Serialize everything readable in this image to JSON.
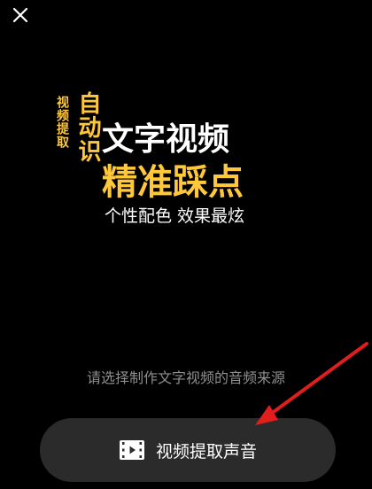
{
  "header": {
    "close_icon": "close-icon"
  },
  "promo": {
    "vertical_small": "视频提取",
    "vertical_big": "自动识",
    "line1": "文字视频",
    "line2": "精准踩点",
    "line3": "个性配色 效果最炫"
  },
  "hint": "请选择制作文字视频的音频来源",
  "extract_button": {
    "icon": "video-film-icon",
    "label": "视频提取声音"
  },
  "colors": {
    "accent": "#ffc83a",
    "background": "#000000",
    "button_bg": "#2b2b2b",
    "hint_text": "#8e8e8e",
    "annotation_arrow": "#e01e1e"
  }
}
